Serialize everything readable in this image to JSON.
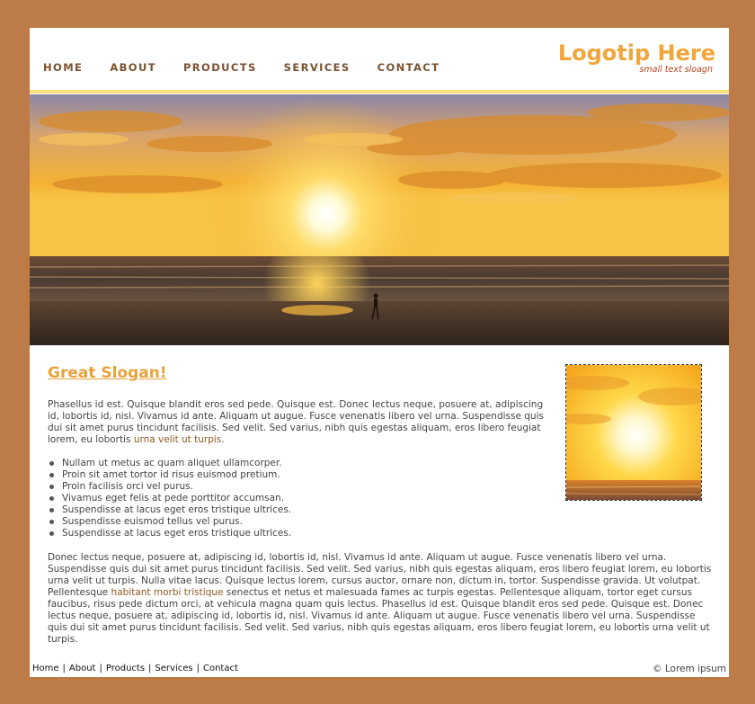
{
  "logo": {
    "name": "Logotip Here",
    "slogan": "small text sloagn"
  },
  "nav": [
    "HOME",
    "ABOUT",
    "PRODUCTS",
    "SERVICES",
    "CONTACT"
  ],
  "content": {
    "title": "Great Slogan!",
    "para1_text": "Phasellus id est. Quisque blandit eros sed pede. Quisque est. Donec lectus neque, posuere at, adipiscing id, lobortis id, nisl. Vivamus id ante. Aliquam ut augue. Fusce venenatis libero vel urna. Suspendisse quis dui sit amet purus tincidunt facilisis. Sed velit. Sed varius, nibh quis egestas aliquam, eros libero feugiat lorem, eu lobortis ",
    "para1_link": "urna velit ut turpis",
    "para1_end": ".",
    "bullets": [
      "Nullam ut metus ac quam aliquet ullamcorper.",
      "Proin sit amet tortor id risus euismod pretium.",
      "Proin facilisis orci vel purus.",
      "Vivamus eget felis at pede porttitor accumsan.",
      "Suspendisse at lacus eget eros tristique ultrices.",
      "Suspendisse euismod tellus vel purus.",
      "Suspendisse at lacus eget eros tristique ultrices."
    ],
    "para2_text": "Donec lectus neque, posuere at, adipiscing id, lobortis id, nisl. Vivamus id ante. Aliquam ut augue. Fusce venenatis libero vel urna. Suspendisse quis dui sit amet purus tincidunt facilisis. Sed velit. Sed varius, nibh quis egestas aliquam, eros libero feugiat lorem, eu lobortis urna velit ut turpis. Nulla vitae lacus. Quisque lectus lorem, cursus auctor, ornare non, dictum in, tortor. Suspendisse gravida. Ut volutpat. Pellentesque ",
    "para2_link": "habitant morbi tristique",
    "para2_end": " senectus et netus et malesuada fames ac turpis egestas. Pellentesque aliquam, tortor eget cursus faucibus, risus pede dictum orci, at vehicula magna quam quis lectus. Phasellus id est. Quisque blandit eros sed pede. Quisque est. Donec lectus neque, posuere at, adipiscing id, lobortis id, nisl. Vivamus id ante. Aliquam ut augue. Fusce venenatis libero vel urna. Suspendisse quis dui sit amet purus tincidunt facilisis. Sed velit. Sed varius, nibh quis egestas aliquam, eros libero feugiat lorem, eu lobortis urna velit ut turpis."
  },
  "footer": {
    "links": [
      "Home",
      "About",
      "Products",
      "Services",
      "Contact"
    ],
    "separator": "|",
    "copyright": "© Lorem ipsum"
  },
  "colors": {
    "background": "#bd7b47",
    "logo": "#f0a63a",
    "nav": "#7a5231",
    "accent_bar": "#fbe07a",
    "title": "#e9a23a"
  },
  "images": {
    "hero": "sunset-beach-photo",
    "thumbnail": "sunset-closeup-photo"
  }
}
